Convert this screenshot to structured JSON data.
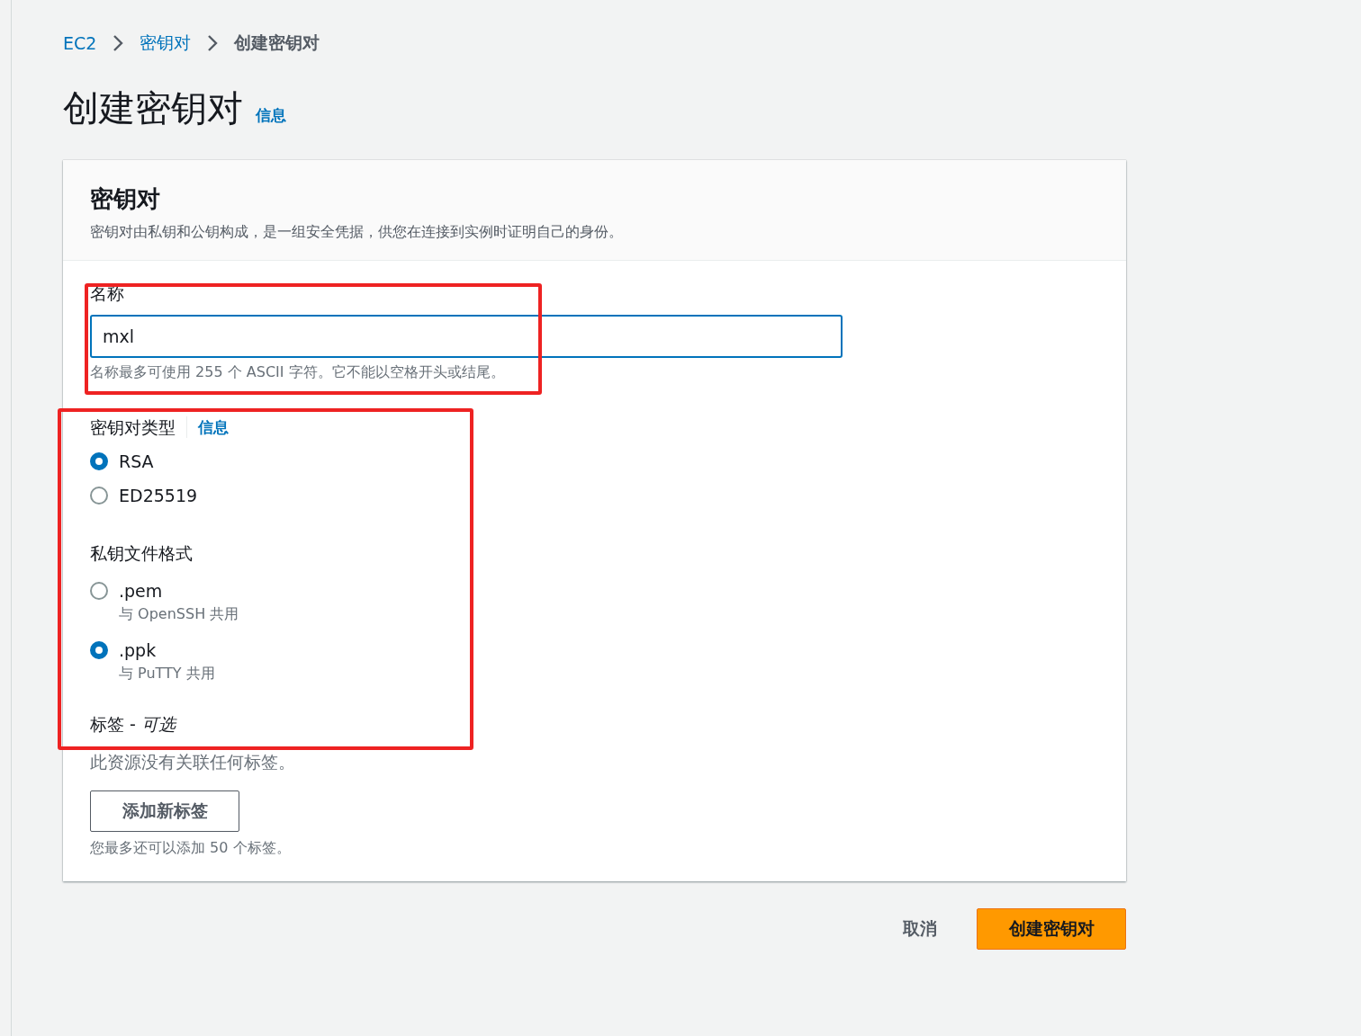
{
  "breadcrumb": [
    {
      "label": "EC2",
      "link": true
    },
    {
      "label": "密钥对",
      "link": true
    },
    {
      "label": "创建密钥对",
      "link": false
    }
  ],
  "page_title": "创建密钥对",
  "page_info_link": "信息",
  "panel": {
    "title": "密钥对",
    "description": "密钥对由私钥和公钥构成，是一组安全凭据，供您在连接到实例时证明自己的身份。",
    "name_field": {
      "label": "名称",
      "value": "mxl",
      "hint": "名称最多可使用 255 个 ASCII 字符。它不能以空格开头或结尾。"
    },
    "key_type": {
      "label": "密钥对类型",
      "info_link": "信息",
      "options": [
        {
          "label": "RSA",
          "selected": true
        },
        {
          "label": "ED25519",
          "selected": false
        }
      ]
    },
    "file_format": {
      "label": "私钥文件格式",
      "options": [
        {
          "label": ".pem",
          "description": "与 OpenSSH 共用",
          "selected": false
        },
        {
          "label": ".ppk",
          "description": "与 PuTTY 共用",
          "selected": true
        }
      ]
    },
    "tags": {
      "label": "标签 - *可选*",
      "empty_text": "此资源没有关联任何标签。",
      "add_button": "添加新标签",
      "limit_text": "您最多还可以添加 50 个标签。"
    }
  },
  "actions": {
    "cancel": "取消",
    "submit": "创建密钥对"
  }
}
